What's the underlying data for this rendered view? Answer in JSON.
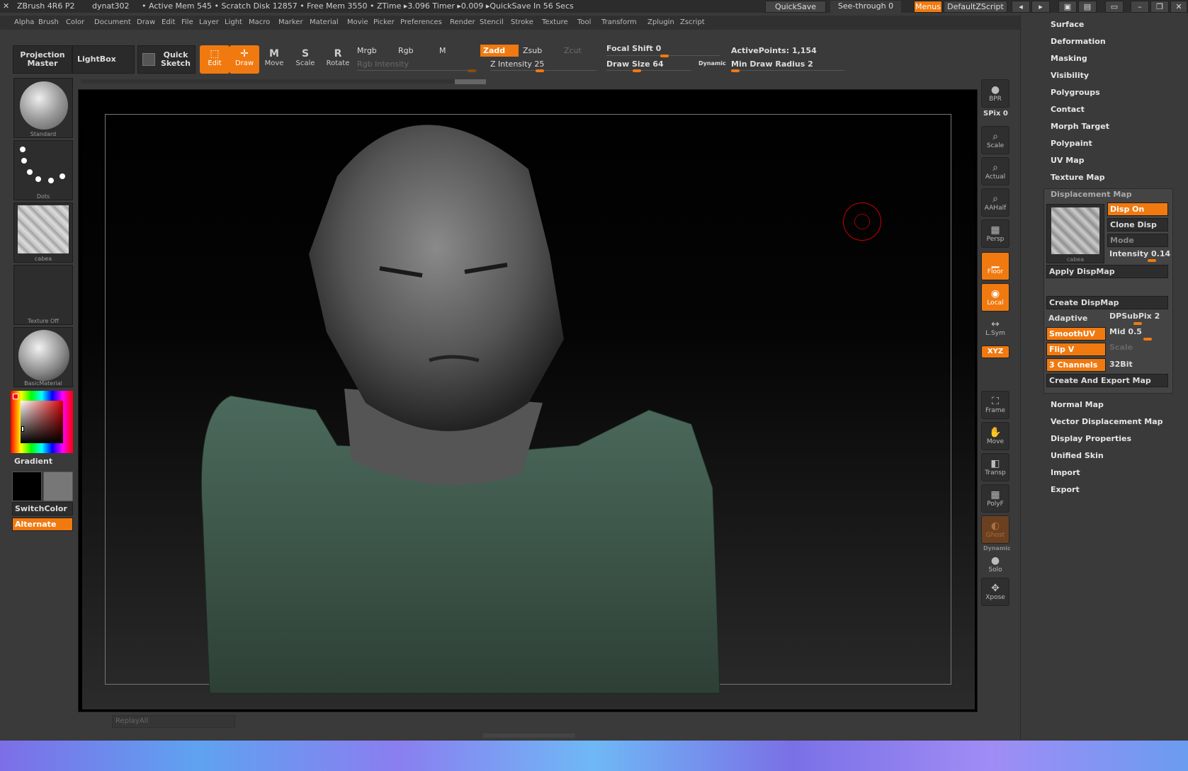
{
  "titlebar": {
    "app": "ZBrush 4R6 P2",
    "doc": "dynat302",
    "status": "• Active Mem 545 • Scratch Disk 12857 • Free Mem 3550 • ZTime ▸3.096 Timer ▸0.009 ▸QuickSave In 56 Secs",
    "quicksave": "QuickSave",
    "see_through": "See-through  0",
    "menus": "Menus",
    "zscript": "DefaultZScript"
  },
  "menubar": [
    "Alpha",
    "Brush",
    "Color",
    "Document",
    "Draw",
    "Edit",
    "File",
    "Layer",
    "Light",
    "Macro",
    "Marker",
    "Material",
    "Movie",
    "Picker",
    "Preferences",
    "Render",
    "Stencil",
    "Stroke",
    "Texture",
    "Tool",
    "Transform",
    "Zplugin",
    "Zscript"
  ],
  "shelf": {
    "projection_master": "Projection Master",
    "lightbox": "LightBox",
    "quick_sketch": "Quick Sketch",
    "edit": "Edit",
    "draw": "Draw",
    "move": "Move",
    "scale": "Scale",
    "rotate": "Rotate",
    "mrgb": "Mrgb",
    "rgb": "Rgb",
    "m": "M",
    "zadd": "Zadd",
    "zsub": "Zsub",
    "zcut": "Zcut",
    "rgb_intensity": "Rgb Intensity",
    "z_intensity": "Z Intensity 25",
    "focal_shift": "Focal Shift 0",
    "draw_size": "Draw Size 64",
    "dynamic": "Dynamic",
    "active_points": "ActivePoints: 1,154",
    "min_draw_radius": "Min Draw Radius 2"
  },
  "left_tray": {
    "brush": "Standard",
    "stroke": "Dots",
    "alpha": "cabea",
    "texture": "Texture Off",
    "material": "BasicMaterial",
    "gradient": "Gradient",
    "switchcolor": "SwitchColor",
    "alternate": "Alternate"
  },
  "right_tools": {
    "bpr": "BPR",
    "spix": "SPix 0",
    "scale": "Scale",
    "actual": "Actual",
    "aahalf": "AAHalf",
    "persp": "Persp",
    "floor": "Floor",
    "local": "Local",
    "lsym": "L.Sym",
    "xyz": "XYZ",
    "frame": "Frame",
    "move": "Move",
    "transp": "Transp",
    "polyf": "PolyF",
    "ghost": "Ghost",
    "dynamic": "Dynamic",
    "solo": "Solo",
    "xpose": "Xpose"
  },
  "right_panel": {
    "items_top": [
      "Surface",
      "Deformation",
      "Masking",
      "Visibility",
      "Polygroups",
      "Contact",
      "Morph Target",
      "Polypaint",
      "UV Map",
      "Texture Map"
    ],
    "items_bottom": [
      "Normal Map",
      "Vector Displacement Map",
      "Display Properties",
      "Unified Skin",
      "Import",
      "Export"
    ],
    "dispmap": {
      "title": "Displacement Map",
      "thumb_label": "cabea",
      "disp_on": "Disp On",
      "clone_disp": "Clone Disp",
      "mode": "Mode",
      "intensity": "Intensity 0.14",
      "apply": "Apply DispMap",
      "create": "Create DispMap",
      "adaptive": "Adaptive",
      "dpsubpix": "DPSubPix 2",
      "smoothuv": "SmoothUV",
      "mid": "Mid 0.5",
      "flipv": "Flip V",
      "scale": "Scale",
      "channels": "3 Channels",
      "bit32": "32Bit",
      "create_export": "Create And Export Map"
    }
  },
  "canvas": {
    "replay": "ReplayAll"
  },
  "colors": {
    "accent": "#f07a10",
    "bg": "#3a3a3a"
  }
}
